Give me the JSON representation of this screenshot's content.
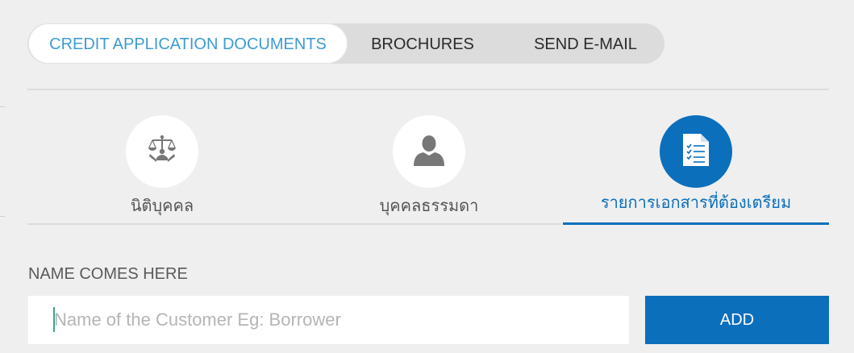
{
  "tabs": [
    {
      "label": "CREDIT APPLICATION DOCUMENTS",
      "active": true
    },
    {
      "label": "BROCHURES",
      "active": false
    },
    {
      "label": "SEND E-MAIL",
      "active": false
    }
  ],
  "categories": [
    {
      "label": "นิติบุคคล",
      "icon": "scales-icon",
      "active": false
    },
    {
      "label": "บุคคลธรรมดา",
      "icon": "person-icon",
      "active": false
    },
    {
      "label": "รายการเอกสารที่ต้องเตรียม",
      "icon": "document-checklist-icon",
      "active": true
    }
  ],
  "form": {
    "section_label": "NAME COMES HERE",
    "name_placeholder": "Name of the Customer Eg: Borrower",
    "name_value": "",
    "add_label": "ADD"
  },
  "colors": {
    "accent": "#0b6fbc",
    "tab_active_text": "#3d9bd2",
    "background": "#efefef"
  }
}
